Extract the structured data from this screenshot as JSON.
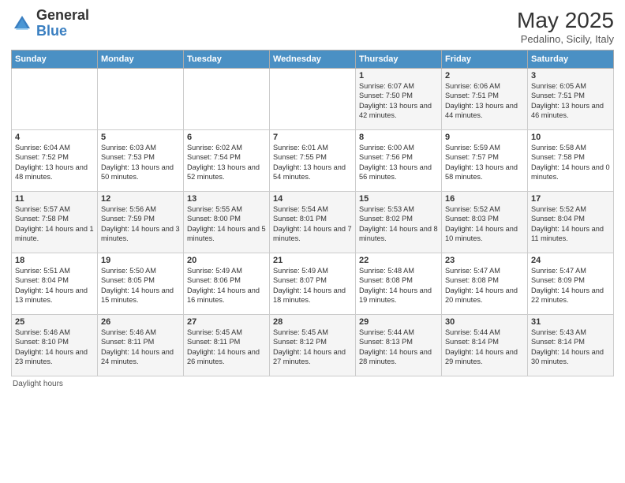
{
  "header": {
    "logo_general": "General",
    "logo_blue": "Blue",
    "month": "May 2025",
    "location": "Pedalino, Sicily, Italy"
  },
  "days_of_week": [
    "Sunday",
    "Monday",
    "Tuesday",
    "Wednesday",
    "Thursday",
    "Friday",
    "Saturday"
  ],
  "footer": "Daylight hours",
  "weeks": [
    [
      {
        "day": "",
        "sunrise": "",
        "sunset": "",
        "daylight": ""
      },
      {
        "day": "",
        "sunrise": "",
        "sunset": "",
        "daylight": ""
      },
      {
        "day": "",
        "sunrise": "",
        "sunset": "",
        "daylight": ""
      },
      {
        "day": "",
        "sunrise": "",
        "sunset": "",
        "daylight": ""
      },
      {
        "day": "1",
        "sunrise": "Sunrise: 6:07 AM",
        "sunset": "Sunset: 7:50 PM",
        "daylight": "Daylight: 13 hours and 42 minutes."
      },
      {
        "day": "2",
        "sunrise": "Sunrise: 6:06 AM",
        "sunset": "Sunset: 7:51 PM",
        "daylight": "Daylight: 13 hours and 44 minutes."
      },
      {
        "day": "3",
        "sunrise": "Sunrise: 6:05 AM",
        "sunset": "Sunset: 7:51 PM",
        "daylight": "Daylight: 13 hours and 46 minutes."
      }
    ],
    [
      {
        "day": "4",
        "sunrise": "Sunrise: 6:04 AM",
        "sunset": "Sunset: 7:52 PM",
        "daylight": "Daylight: 13 hours and 48 minutes."
      },
      {
        "day": "5",
        "sunrise": "Sunrise: 6:03 AM",
        "sunset": "Sunset: 7:53 PM",
        "daylight": "Daylight: 13 hours and 50 minutes."
      },
      {
        "day": "6",
        "sunrise": "Sunrise: 6:02 AM",
        "sunset": "Sunset: 7:54 PM",
        "daylight": "Daylight: 13 hours and 52 minutes."
      },
      {
        "day": "7",
        "sunrise": "Sunrise: 6:01 AM",
        "sunset": "Sunset: 7:55 PM",
        "daylight": "Daylight: 13 hours and 54 minutes."
      },
      {
        "day": "8",
        "sunrise": "Sunrise: 6:00 AM",
        "sunset": "Sunset: 7:56 PM",
        "daylight": "Daylight: 13 hours and 56 minutes."
      },
      {
        "day": "9",
        "sunrise": "Sunrise: 5:59 AM",
        "sunset": "Sunset: 7:57 PM",
        "daylight": "Daylight: 13 hours and 58 minutes."
      },
      {
        "day": "10",
        "sunrise": "Sunrise: 5:58 AM",
        "sunset": "Sunset: 7:58 PM",
        "daylight": "Daylight: 14 hours and 0 minutes."
      }
    ],
    [
      {
        "day": "11",
        "sunrise": "Sunrise: 5:57 AM",
        "sunset": "Sunset: 7:58 PM",
        "daylight": "Daylight: 14 hours and 1 minute."
      },
      {
        "day": "12",
        "sunrise": "Sunrise: 5:56 AM",
        "sunset": "Sunset: 7:59 PM",
        "daylight": "Daylight: 14 hours and 3 minutes."
      },
      {
        "day": "13",
        "sunrise": "Sunrise: 5:55 AM",
        "sunset": "Sunset: 8:00 PM",
        "daylight": "Daylight: 14 hours and 5 minutes."
      },
      {
        "day": "14",
        "sunrise": "Sunrise: 5:54 AM",
        "sunset": "Sunset: 8:01 PM",
        "daylight": "Daylight: 14 hours and 7 minutes."
      },
      {
        "day": "15",
        "sunrise": "Sunrise: 5:53 AM",
        "sunset": "Sunset: 8:02 PM",
        "daylight": "Daylight: 14 hours and 8 minutes."
      },
      {
        "day": "16",
        "sunrise": "Sunrise: 5:52 AM",
        "sunset": "Sunset: 8:03 PM",
        "daylight": "Daylight: 14 hours and 10 minutes."
      },
      {
        "day": "17",
        "sunrise": "Sunrise: 5:52 AM",
        "sunset": "Sunset: 8:04 PM",
        "daylight": "Daylight: 14 hours and 11 minutes."
      }
    ],
    [
      {
        "day": "18",
        "sunrise": "Sunrise: 5:51 AM",
        "sunset": "Sunset: 8:04 PM",
        "daylight": "Daylight: 14 hours and 13 minutes."
      },
      {
        "day": "19",
        "sunrise": "Sunrise: 5:50 AM",
        "sunset": "Sunset: 8:05 PM",
        "daylight": "Daylight: 14 hours and 15 minutes."
      },
      {
        "day": "20",
        "sunrise": "Sunrise: 5:49 AM",
        "sunset": "Sunset: 8:06 PM",
        "daylight": "Daylight: 14 hours and 16 minutes."
      },
      {
        "day": "21",
        "sunrise": "Sunrise: 5:49 AM",
        "sunset": "Sunset: 8:07 PM",
        "daylight": "Daylight: 14 hours and 18 minutes."
      },
      {
        "day": "22",
        "sunrise": "Sunrise: 5:48 AM",
        "sunset": "Sunset: 8:08 PM",
        "daylight": "Daylight: 14 hours and 19 minutes."
      },
      {
        "day": "23",
        "sunrise": "Sunrise: 5:47 AM",
        "sunset": "Sunset: 8:08 PM",
        "daylight": "Daylight: 14 hours and 20 minutes."
      },
      {
        "day": "24",
        "sunrise": "Sunrise: 5:47 AM",
        "sunset": "Sunset: 8:09 PM",
        "daylight": "Daylight: 14 hours and 22 minutes."
      }
    ],
    [
      {
        "day": "25",
        "sunrise": "Sunrise: 5:46 AM",
        "sunset": "Sunset: 8:10 PM",
        "daylight": "Daylight: 14 hours and 23 minutes."
      },
      {
        "day": "26",
        "sunrise": "Sunrise: 5:46 AM",
        "sunset": "Sunset: 8:11 PM",
        "daylight": "Daylight: 14 hours and 24 minutes."
      },
      {
        "day": "27",
        "sunrise": "Sunrise: 5:45 AM",
        "sunset": "Sunset: 8:11 PM",
        "daylight": "Daylight: 14 hours and 26 minutes."
      },
      {
        "day": "28",
        "sunrise": "Sunrise: 5:45 AM",
        "sunset": "Sunset: 8:12 PM",
        "daylight": "Daylight: 14 hours and 27 minutes."
      },
      {
        "day": "29",
        "sunrise": "Sunrise: 5:44 AM",
        "sunset": "Sunset: 8:13 PM",
        "daylight": "Daylight: 14 hours and 28 minutes."
      },
      {
        "day": "30",
        "sunrise": "Sunrise: 5:44 AM",
        "sunset": "Sunset: 8:14 PM",
        "daylight": "Daylight: 14 hours and 29 minutes."
      },
      {
        "day": "31",
        "sunrise": "Sunrise: 5:43 AM",
        "sunset": "Sunset: 8:14 PM",
        "daylight": "Daylight: 14 hours and 30 minutes."
      }
    ]
  ]
}
